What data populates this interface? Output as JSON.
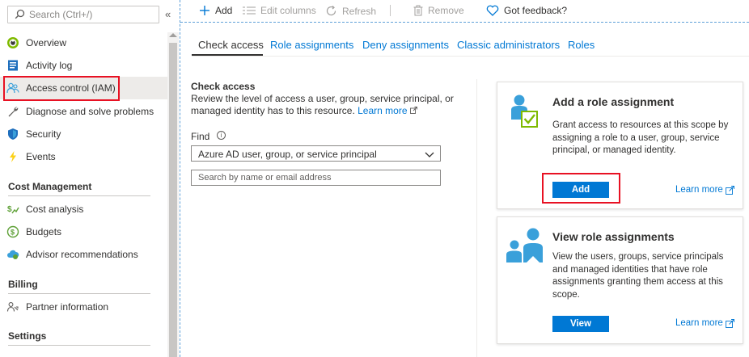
{
  "sidebar": {
    "search_placeholder": "Search (Ctrl+/)",
    "collapse_glyph": "«",
    "items": [
      {
        "label": "Overview",
        "icon": "overview-icon"
      },
      {
        "label": "Activity log",
        "icon": "activity-log-icon"
      },
      {
        "label": "Access control (IAM)",
        "icon": "iam-icon",
        "active": true
      },
      {
        "label": "Diagnose and solve problems",
        "icon": "wrench-icon"
      },
      {
        "label": "Security",
        "icon": "shield-icon"
      },
      {
        "label": "Events",
        "icon": "lightning-icon"
      }
    ],
    "sections": [
      {
        "title": "Cost Management",
        "items": [
          {
            "label": "Cost analysis",
            "icon": "cost-analysis-icon"
          },
          {
            "label": "Budgets",
            "icon": "budgets-icon"
          },
          {
            "label": "Advisor recommendations",
            "icon": "cloud-advisor-icon"
          }
        ]
      },
      {
        "title": "Billing",
        "items": [
          {
            "label": "Partner information",
            "icon": "partner-icon"
          }
        ]
      },
      {
        "title": "Settings",
        "items": []
      }
    ]
  },
  "toolbar": {
    "add": "Add",
    "edit_columns": "Edit columns",
    "refresh": "Refresh",
    "remove": "Remove",
    "feedback": "Got feedback?"
  },
  "tabs": [
    {
      "label": "Check access",
      "active": true
    },
    {
      "label": "Role assignments"
    },
    {
      "label": "Deny assignments"
    },
    {
      "label": "Classic administrators"
    },
    {
      "label": "Roles"
    }
  ],
  "check_access": {
    "title": "Check access",
    "description": "Review the level of access a user, group, service principal, or managed identity has to this resource.",
    "learn_more": "Learn more",
    "find_label": "Find",
    "find_info": "i",
    "find_value": "Azure AD user, group, or service principal",
    "search_placeholder": "Search by name or email address"
  },
  "cards": {
    "add_role": {
      "title": "Add a role assignment",
      "description": "Grant access to resources at this scope by assigning a role to a user, group, service principal, or managed identity.",
      "button": "Add",
      "link": "Learn more"
    },
    "view_role": {
      "title": "View role assignments",
      "description": "View the users, groups, service principals and managed identities that have role assignments granting them access at this scope.",
      "button": "View",
      "link": "Learn more"
    }
  },
  "colors": {
    "accent": "#0078d4",
    "highlight": "#e81123",
    "icon_blue": "#3aa0da",
    "icon_green": "#7fba00"
  }
}
